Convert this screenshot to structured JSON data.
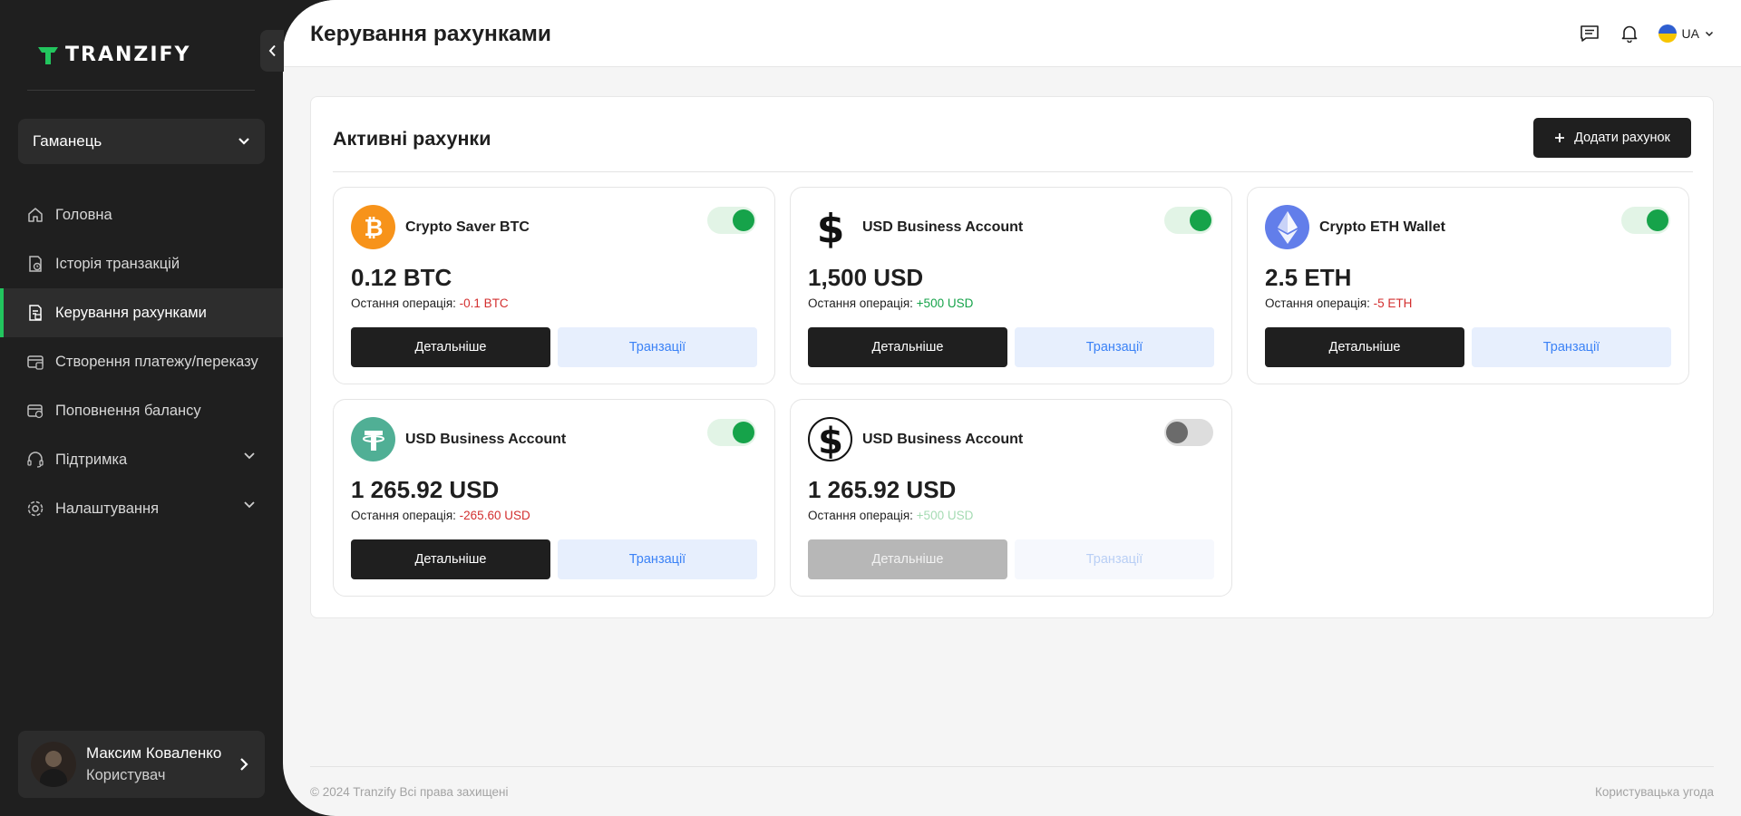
{
  "app": {
    "logo_text": "TRANZIFY"
  },
  "sidebar": {
    "wallet_select": "Гаманець",
    "items": [
      {
        "label": "Головна",
        "icon": "home-icon"
      },
      {
        "label": "Історія транзакцій",
        "icon": "history-document-icon"
      },
      {
        "label": "Керування рахунками",
        "icon": "accounts-document-icon",
        "active": true
      },
      {
        "label": "Створення платежу/переказу",
        "icon": "payment-card-icon"
      },
      {
        "label": "Поповнення балансу",
        "icon": "wallet-topup-icon"
      },
      {
        "label": "Підтримка",
        "icon": "headset-icon",
        "expandable": true
      },
      {
        "label": "Налаштування",
        "icon": "gear-icon",
        "expandable": true
      }
    ],
    "user": {
      "name": "Максим Коваленко",
      "role": "Користувач"
    }
  },
  "header": {
    "title": "Керування рахунками",
    "language": "UA"
  },
  "main": {
    "section_title": "Активні рахунки",
    "add_button": "Додати рахунок",
    "cards": [
      {
        "name": "Crypto Saver BTC",
        "icon": "bitcoin-icon",
        "amount": "0.12 BTC",
        "last_label": "Остання операція:",
        "last_value": "-0.1 BTC",
        "last_type": "negative",
        "enabled": true,
        "details_label": "Детальніше",
        "tx_label": "Транзації"
      },
      {
        "name": "USD Business Account",
        "icon": "dollar-icon",
        "amount": "1,500 USD",
        "last_label": "Остання операція:",
        "last_value": "+500 USD",
        "last_type": "positive",
        "enabled": true,
        "details_label": "Детальніше",
        "tx_label": "Транзації"
      },
      {
        "name": "Crypto ETH Wallet",
        "icon": "ethereum-icon",
        "amount": "2.5 ETH",
        "last_label": "Остання операція:",
        "last_value": "-5 ETH",
        "last_type": "negative",
        "enabled": true,
        "details_label": "Детальніше",
        "tx_label": "Транзації"
      },
      {
        "name": "USD Business Account",
        "icon": "tether-icon",
        "amount": "1 265.92 USD",
        "last_label": "Остання операція:",
        "last_value": "-265.60 USD",
        "last_type": "negative",
        "enabled": true,
        "details_label": "Детальніше",
        "tx_label": "Транзації"
      },
      {
        "name": "USD Business Account",
        "icon": "dollar-circle-icon",
        "amount": "1 265.92 USD",
        "last_label": "Остання операція:",
        "last_value": "+500 USD",
        "last_type": "positive",
        "enabled": false,
        "details_label": "Детальніше",
        "tx_label": "Транзації"
      }
    ]
  },
  "footer": {
    "copyright": "© 2024 Tranzify Всі права захищені",
    "terms": "Користувацька угода"
  },
  "colors": {
    "accent_green": "#16a34a",
    "negative_red": "#d32f2f",
    "dark": "#1f1f1f",
    "tx_button_bg": "#e7effd",
    "tx_button_text": "#3b82f6",
    "bitcoin_orange": "#f7931a",
    "ethereum_purple": "#627eea",
    "tether_teal": "#50af95"
  }
}
